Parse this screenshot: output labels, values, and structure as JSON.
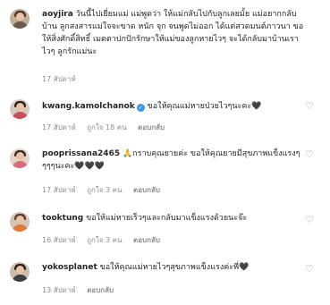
{
  "comments": [
    {
      "username": "aoyjira",
      "verified": false,
      "text": "วันนี้ไปเยี่ยมแม่ แม่พูดว่า ให้แม่กลับไปกับลูกเลยมั้ย แม่อยากกลับบ้าน ลูกสงสารแม่ใจจะขาด หนัก จุก จนพูดไม่ออก ได้แต่สวดมนต์ภาวนา ขอให้สิ่งศักดิ์สิทธิ์ เมตตาปกปักรักษาให้แม่ของลูกหายไวๆ จะได้กลับมาบ้านเราไวๆ ลูกรักแม่นะ",
      "time": "17 สัปดาห์",
      "likes": "",
      "reply_label": ""
    },
    {
      "username": "kwang.kamolchanok",
      "verified": true,
      "text": "ขอให้คุณแม่หายป่วยไวๆนะคะ🖤",
      "time": "17 สัปดาห์",
      "likes": "ถูกใจ 18 คน",
      "reply_label": "ตอบกลับ"
    },
    {
      "username": "pooprissana2465",
      "verified": false,
      "text": "🙏กราบคุณยายค่ะ ขอให้คุณยายมีสุขภาพแข็งแรงๆๆๆๆนะคะ🖤🖤🖤",
      "time": "17 สัปดาห์",
      "likes": "ถูกใจ 3 คน",
      "reply_label": "ตอบกลับ"
    },
    {
      "username": "tooktung",
      "verified": false,
      "text": "ขอให้แม่หายเร็วๆและกลับมาแข็งแรงด้วยนะจ๊ะ",
      "time": "16 สัปดาห์",
      "likes": "ถูกใจ 3 คน",
      "reply_label": "ตอบกลับ"
    },
    {
      "username": "yokosplanet",
      "verified": false,
      "text": "ขอให้คุณแม่หายไวๆสุขภาพแข็งแรงค่ะพี่🖤",
      "time": "13 สัปดาห์",
      "likes": "",
      "reply_label": "ตอบกลับ"
    }
  ],
  "colors": {
    "text": "#262626",
    "muted": "#8e8e8e",
    "verified": "#3897f0"
  },
  "icons": {
    "like": "heart-outline-icon",
    "verified": "verified-badge-icon"
  }
}
